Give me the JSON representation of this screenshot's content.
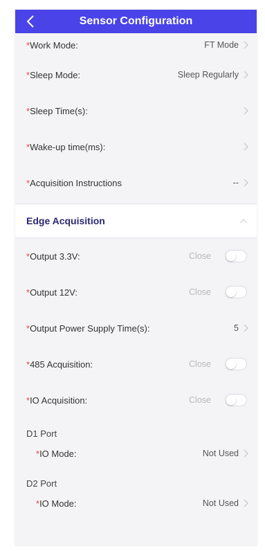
{
  "header": {
    "title": "Sensor Configuration",
    "back_icon": "chevron-left-icon"
  },
  "required_mark": "*",
  "top_rows": [
    {
      "label": "Work Mode:",
      "value": "FT Mode"
    },
    {
      "label": "Sleep Mode:",
      "value": "Sleep Regularly"
    },
    {
      "label": "Sleep Time(s):",
      "value": ""
    },
    {
      "label": "Wake-up time(ms):",
      "value": ""
    },
    {
      "label": "Acquisition Instructions",
      "value": "--"
    }
  ],
  "edge_section": {
    "title": "Edge Acquisition",
    "collapse_icon": "chevron-up-icon"
  },
  "edge_rows": [
    {
      "label": "Output 3.3V:",
      "status": "Close",
      "enabled": false
    },
    {
      "label": "Output 12V:",
      "status": "Close",
      "enabled": false
    },
    {
      "label": "Output Power Supply Time(s):",
      "value": "5"
    },
    {
      "label": "485 Acquisition:",
      "status": "Close",
      "enabled": false
    },
    {
      "label": "IO Acquisition:",
      "status": "Close",
      "enabled": false
    }
  ],
  "ports": [
    {
      "name": "D1 Port",
      "field_label": "IO Mode:",
      "value": "Not Used"
    },
    {
      "name": "D2 Port",
      "field_label": "IO Mode:",
      "value": "Not Used"
    }
  ],
  "colors": {
    "header_bg": "#4a43e8",
    "required": "#e0474a",
    "section_title": "#2a2870"
  }
}
